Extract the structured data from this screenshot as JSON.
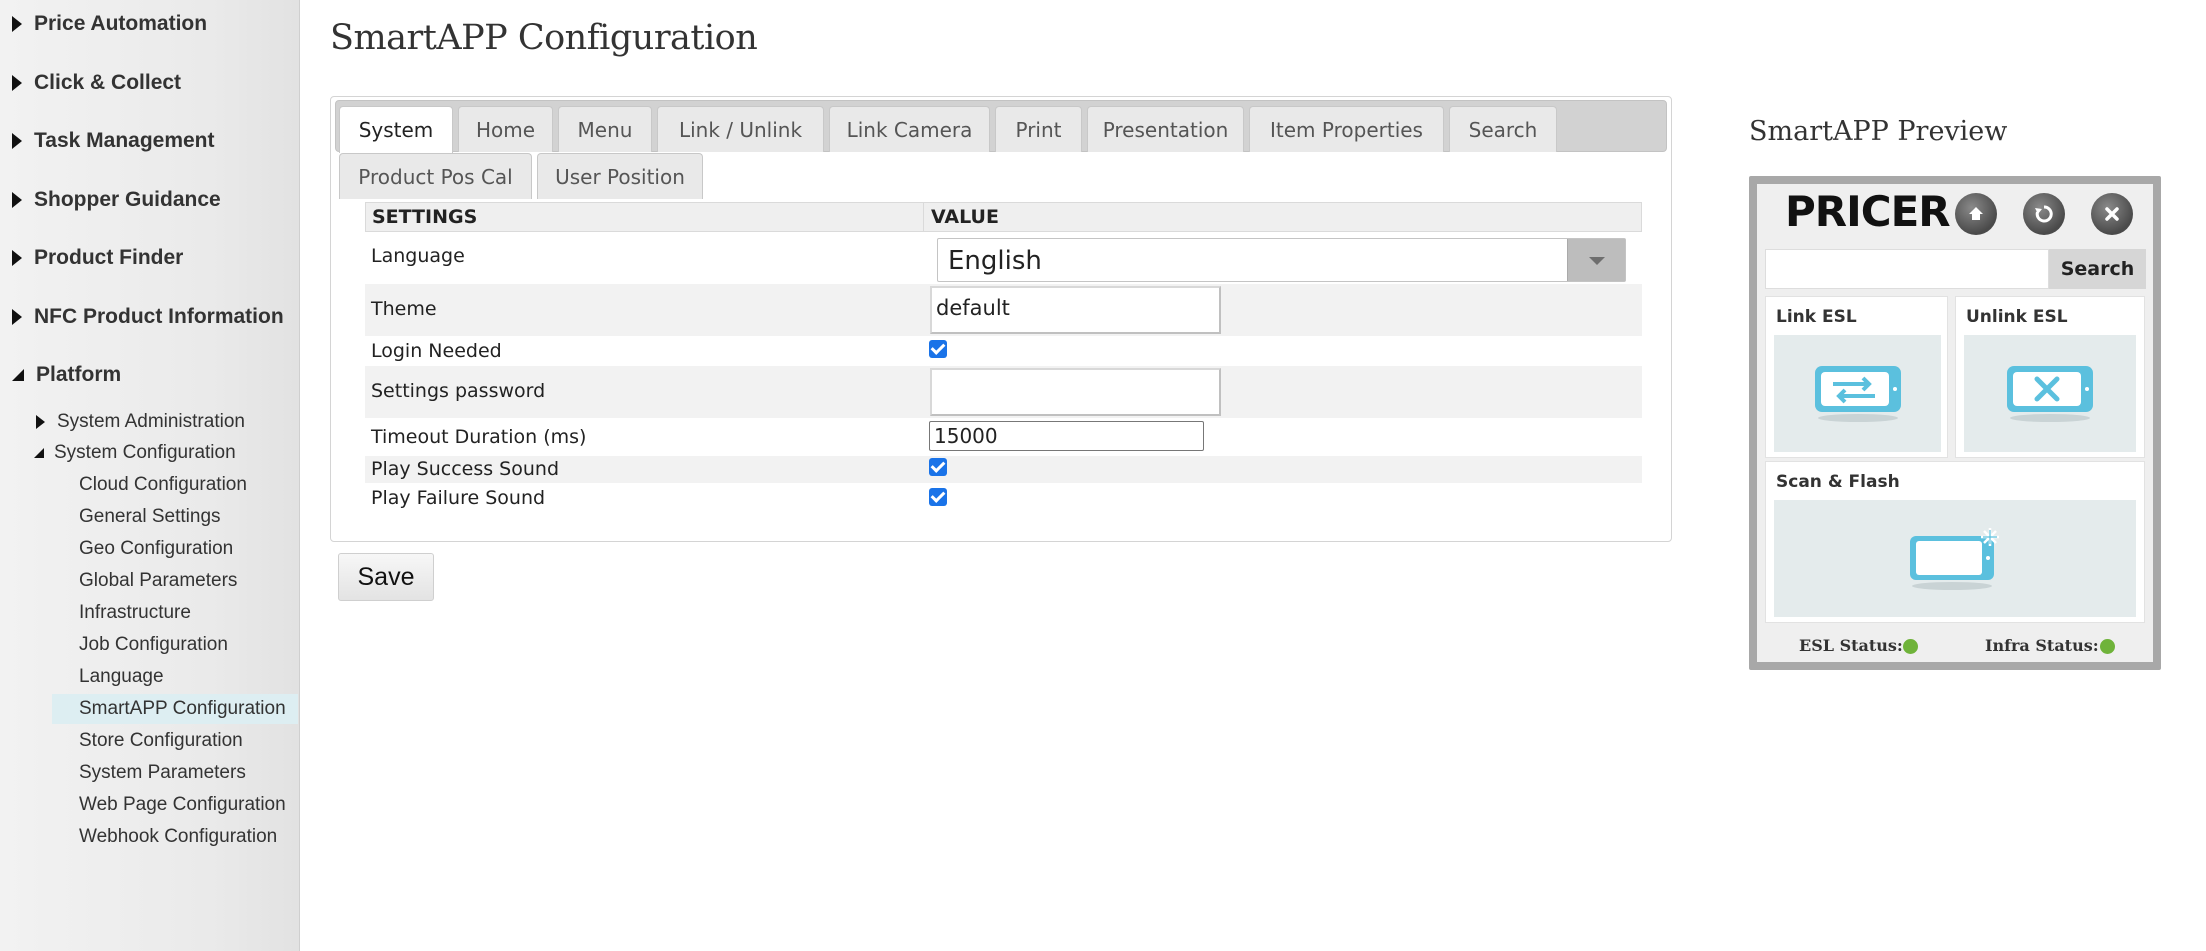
{
  "sidebar": {
    "top_items": [
      {
        "label": "Price Automation",
        "expanded": false
      },
      {
        "label": "Click & Collect",
        "expanded": false
      },
      {
        "label": "Task Management",
        "expanded": false
      },
      {
        "label": "Shopper Guidance",
        "expanded": false
      },
      {
        "label": "Product Finder",
        "expanded": false
      },
      {
        "label": "NFC Product Information",
        "expanded": false
      },
      {
        "label": "Platform",
        "expanded": true
      }
    ],
    "sub_items": [
      {
        "label": "System Administration",
        "expanded": false
      },
      {
        "label": "System Configuration",
        "expanded": true
      }
    ],
    "leaf_items": [
      {
        "label": "Cloud Configuration"
      },
      {
        "label": "General Settings"
      },
      {
        "label": "Geo Configuration"
      },
      {
        "label": "Global Parameters"
      },
      {
        "label": "Infrastructure"
      },
      {
        "label": "Job Configuration"
      },
      {
        "label": "Language"
      },
      {
        "label": "SmartAPP Configuration",
        "active": true
      },
      {
        "label": "Store Configuration"
      },
      {
        "label": "System Parameters"
      },
      {
        "label": "Web Page Configuration"
      },
      {
        "label": "Webhook Configuration"
      }
    ]
  },
  "main": {
    "title": "SmartAPP Configuration",
    "tabs": [
      {
        "label": "System",
        "active": true
      },
      {
        "label": "Home"
      },
      {
        "label": "Menu"
      },
      {
        "label": "Link / Unlink"
      },
      {
        "label": "Link Camera"
      },
      {
        "label": "Print"
      },
      {
        "label": "Presentation"
      },
      {
        "label": "Item Properties"
      },
      {
        "label": "Search"
      },
      {
        "label": "Product Pos Cal"
      },
      {
        "label": "User Position"
      }
    ],
    "table": {
      "headers": [
        "SETTINGS",
        "VALUE"
      ],
      "rows": [
        {
          "label": "Language",
          "type": "select",
          "value": "English"
        },
        {
          "label": "Theme",
          "type": "text",
          "value": "default"
        },
        {
          "label": "Login Needed",
          "type": "checkbox",
          "checked": true
        },
        {
          "label": "Settings password",
          "type": "password",
          "value": ""
        },
        {
          "label": "Timeout Duration (ms)",
          "type": "text",
          "value": "15000"
        },
        {
          "label": "Play Success Sound",
          "type": "checkbox",
          "checked": true
        },
        {
          "label": "Play Failure Sound",
          "type": "checkbox",
          "checked": true
        }
      ]
    },
    "save_label": "Save"
  },
  "preview": {
    "title": "SmartAPP Preview",
    "brand": "PRICER",
    "buttons": {
      "home_icon": "home-icon",
      "refresh_icon": "refresh-icon",
      "close_icon": "close-icon"
    },
    "search_label": "Search",
    "tiles": [
      {
        "label": "Link ESL",
        "icon": "link-esl-icon"
      },
      {
        "label": "Unlink ESL",
        "icon": "unlink-esl-icon"
      },
      {
        "label": "Scan & Flash",
        "icon": "scan-flash-icon"
      }
    ],
    "esl_status_label": "ESL Status:",
    "infra_status_label": "Infra Status:",
    "status_color": "#6fb33a"
  },
  "colors": {
    "accent": "#1a73e8",
    "device_icon": "#5bc0de",
    "active_nav_bg": "#ddeef2"
  }
}
